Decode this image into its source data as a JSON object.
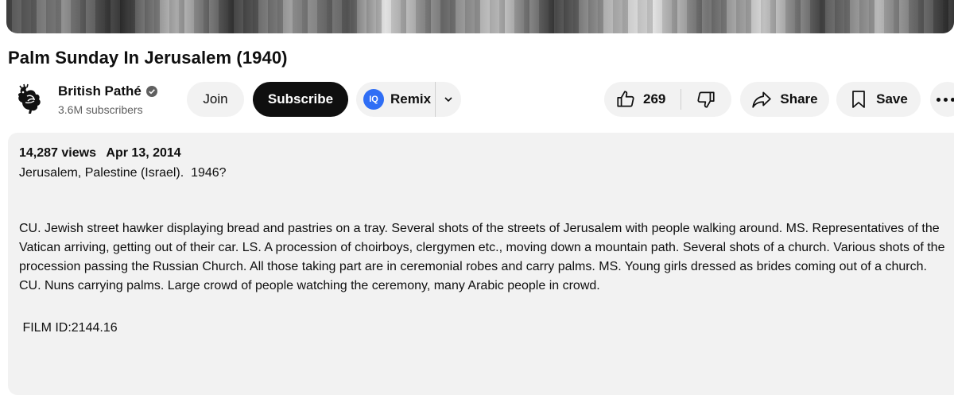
{
  "video": {
    "title": "Palm Sunday In Jerusalem (1940)"
  },
  "channel": {
    "name": "British Pathé",
    "subscribers": "3.6M subscribers",
    "avatar_icon": "rooster-logo-icon",
    "verified_icon": "verified-check-icon"
  },
  "actions": {
    "join_label": "Join",
    "subscribe_label": "Subscribe",
    "remix_logo_text": "IQ",
    "remix_label": "Remix",
    "like_count": "269",
    "share_label": "Share",
    "save_label": "Save"
  },
  "description": {
    "views": "14,287 views",
    "date": "Apr 13, 2014",
    "line1": "Jerusalem, Palestine (Israel).  1946?",
    "body": "CU. Jewish street hawker displaying bread and pastries on a tray. Several shots of the streets of Jerusalem with people walking around. MS. Representatives of the Vatican arriving, getting out of their car. LS. A procession of choirboys, clergymen etc., moving down a mountain path. Several shots of a church. Various shots of the procession passing the Russian Church. All those taking part are in ceremonial robes and carry palms. MS. Young girls dressed as brides coming out of a church. CU. Nuns carrying palms. Large crowd of people watching the ceremony, many Arabic people in crowd.",
    "film_id": " FILM ID:2144.16"
  },
  "colors": {
    "subscribe_bg": "#0f0f0f",
    "pill_bg": "#f2f2f2",
    "description_bg": "#f2f2f2",
    "remix_logo_bg": "#2f6ef5"
  }
}
